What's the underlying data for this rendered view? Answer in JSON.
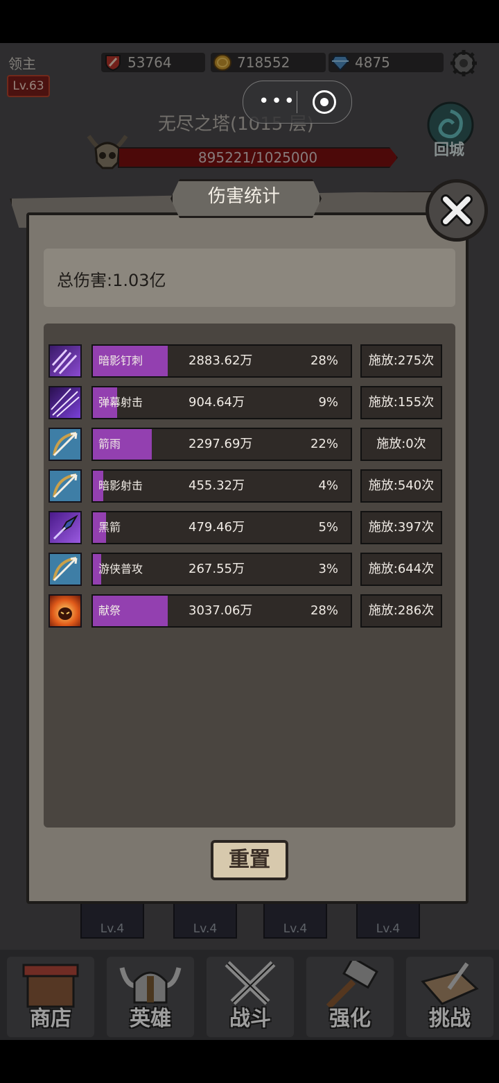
{
  "hud": {
    "player_name": "领主",
    "level": "Lv.63",
    "power": "53764",
    "gold": "718552",
    "gems": "4875"
  },
  "mini_program": {
    "more_label": "•••"
  },
  "boss": {
    "stage_title": "无尽之塔(1015 层)",
    "hp_text": "895221/1025000",
    "return_label": "回城"
  },
  "skill_strip": [
    {
      "level": "Lv.4"
    },
    {
      "level": "Lv.4"
    },
    {
      "level": "Lv.4"
    },
    {
      "level": "Lv.4"
    }
  ],
  "nav": [
    {
      "label": "商店"
    },
    {
      "label": "英雄"
    },
    {
      "label": "战斗"
    },
    {
      "label": "强化"
    },
    {
      "label": "挑战"
    }
  ],
  "modal": {
    "title": "伤害统计",
    "total_damage": "总伤害:1.03亿",
    "reset_label": "重置",
    "rows": [
      {
        "name": "暗影钉刺",
        "damage": "2883.62万",
        "percent": "28%",
        "fraction": 0.28,
        "casts": "施放:275次",
        "icon": "shadow-spikes-icon"
      },
      {
        "name": "弹幕射击",
        "damage": "904.64万",
        "percent": "9%",
        "fraction": 0.09,
        "casts": "施放:155次",
        "icon": "barrage-shot-icon"
      },
      {
        "name": "箭雨",
        "damage": "2297.69万",
        "percent": "22%",
        "fraction": 0.22,
        "casts": "施放:0次",
        "icon": "arrow-rain-icon"
      },
      {
        "name": "暗影射击",
        "damage": "455.32万",
        "percent": "4%",
        "fraction": 0.04,
        "casts": "施放:540次",
        "icon": "shadow-shot-icon"
      },
      {
        "name": "黑箭",
        "damage": "479.46万",
        "percent": "5%",
        "fraction": 0.05,
        "casts": "施放:397次",
        "icon": "black-arrow-icon"
      },
      {
        "name": "游侠普攻",
        "damage": "267.55万",
        "percent": "3%",
        "fraction": 0.03,
        "casts": "施放:644次",
        "icon": "ranger-attack-icon"
      },
      {
        "name": "献祭",
        "damage": "3037.06万",
        "percent": "28%",
        "fraction": 0.28,
        "casts": "施放:286次",
        "icon": "sacrifice-icon"
      }
    ]
  },
  "colors": {
    "bar_fill": "#9340b0",
    "panel": "#7c776f",
    "list_bg": "#4a4540",
    "boss_hp": "#7b1010"
  }
}
